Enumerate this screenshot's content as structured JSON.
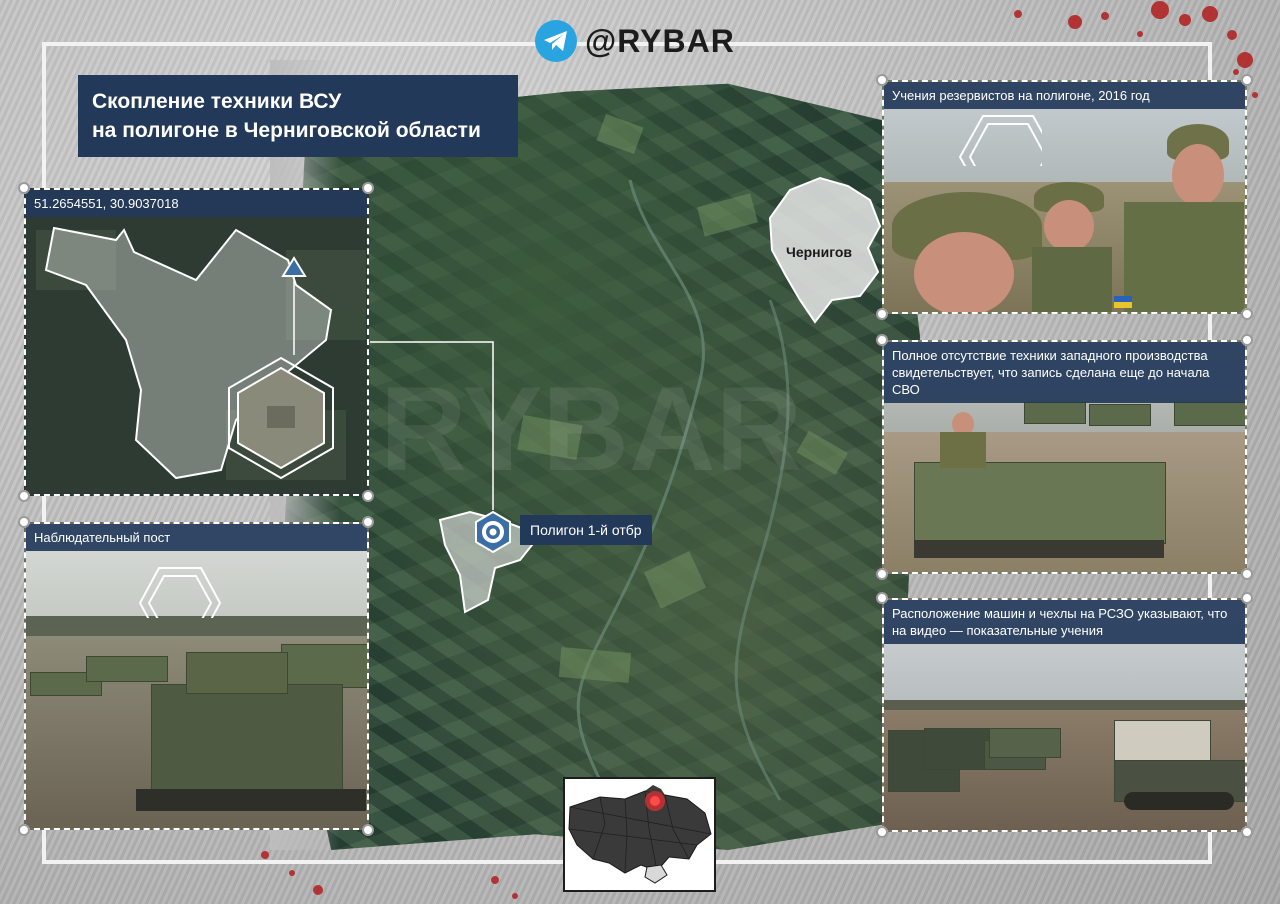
{
  "brand": {
    "handle": "@RYBAR",
    "icon": "telegram-icon",
    "color": "#2aa4e0"
  },
  "title": {
    "line1": "Скопление техники ВСУ",
    "line2": "на полигоне в Черниговской области"
  },
  "map": {
    "city_label": "Чернигов",
    "target_label": "Полигон 1-й отбр",
    "target_icon": "target-icon",
    "watermark": "RYBAR"
  },
  "panels": {
    "satellite": {
      "caption": "51.2654551, 30.9037018"
    },
    "observation": {
      "caption": "Наблюдательный пост"
    },
    "reservists": {
      "caption": "Учения резервистов на полигоне, 2016 год"
    },
    "no_western": {
      "caption": "Полное отсутствие техники западного производства свидетельствует, что запись сделана еще до начала СВО"
    },
    "mlrs": {
      "caption": "Расположение машин и чехлы на РСЗО указывают, что на видео — показательные учения"
    }
  },
  "colors": {
    "accent": "#23395a",
    "marker": "#3a6ea5",
    "highlight": "#e03030"
  }
}
